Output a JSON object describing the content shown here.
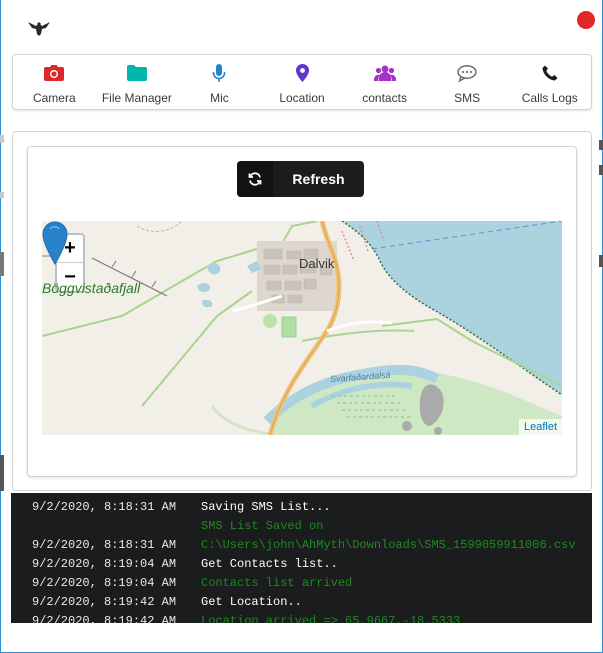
{
  "colors": {
    "accent_border": "#2c8fd6",
    "close": "#e32626",
    "console_bg": "#1b1c1d",
    "success_text": "#1f8a1f"
  },
  "header": {
    "logo_icon": "eagle-icon",
    "close_icon": "red-dot-icon"
  },
  "nav": {
    "items": [
      {
        "label": "Camera",
        "icon": "camera-icon",
        "color": "#db2828"
      },
      {
        "label": "File Manager",
        "icon": "folder-icon",
        "color": "#00b5ad"
      },
      {
        "label": "Mic",
        "icon": "microphone-icon",
        "color": "#2185d0"
      },
      {
        "label": "Location",
        "icon": "map-marker-icon",
        "color": "#6435c9"
      },
      {
        "label": "contacts",
        "icon": "users-icon",
        "color": "#a333c8"
      },
      {
        "label": "SMS",
        "icon": "chat-bubble-icon",
        "color": "#767676"
      },
      {
        "label": "Calls Logs",
        "icon": "phone-icon",
        "color": "#1b1c1d"
      }
    ]
  },
  "location": {
    "refresh_label": "Refresh",
    "map": {
      "zoom_in": "+",
      "zoom_out": "−",
      "town_label": "Dalvik",
      "mountain_label": "Böggvistaðafjall",
      "river_label": "Svarfaðardalsá",
      "attribution": "Leaflet"
    }
  },
  "console": {
    "rows": [
      {
        "time": "9/2/2020, 8:18:31 AM",
        "message": "Saving SMS List...",
        "status": "info"
      },
      {
        "time": "",
        "message": "SMS List Saved on",
        "status": "success"
      },
      {
        "time": "9/2/2020, 8:18:31 AM",
        "message": "C:\\Users\\john\\AhMyth\\Downloads\\SMS_1599059911006.csv",
        "status": "success"
      },
      {
        "time": "9/2/2020, 8:19:04 AM",
        "message": "Get Contacts list..",
        "status": "info"
      },
      {
        "time": "9/2/2020, 8:19:04 AM",
        "message": "Contacts list arrived",
        "status": "success"
      },
      {
        "time": "9/2/2020, 8:19:42 AM",
        "message": "Get Location..",
        "status": "info"
      },
      {
        "time": "9/2/2020, 8:19:42 AM",
        "message": "Location arrived => 65.9667,-18.5333",
        "status": "success"
      }
    ]
  }
}
